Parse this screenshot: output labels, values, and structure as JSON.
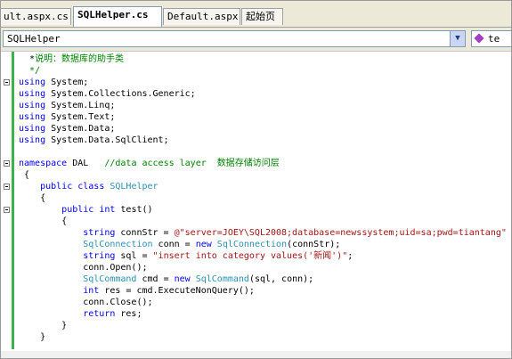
{
  "tabs": [
    {
      "label": "ult.aspx.cs"
    },
    {
      "label": "SQLHelper.cs"
    },
    {
      "label": "Default.aspx"
    },
    {
      "label": "起始页"
    }
  ],
  "nav": {
    "type_combo": "SQLHelper",
    "member_combo": "te"
  },
  "code": {
    "l1": [
      {
        "t": "  *",
        "c": ""
      },
      {
        "t": "说明：数据库的助手类",
        "c": "cm cjk"
      }
    ],
    "l2": [
      {
        "t": "  */",
        "c": "cm"
      }
    ],
    "l3": [
      {
        "t": "using",
        "c": "kw"
      },
      {
        "t": " System;",
        "c": ""
      }
    ],
    "l4": [
      {
        "t": "using",
        "c": "kw"
      },
      {
        "t": " System.Collections.Generic;",
        "c": ""
      }
    ],
    "l5": [
      {
        "t": "using",
        "c": "kw"
      },
      {
        "t": " System.Linq;",
        "c": ""
      }
    ],
    "l6": [
      {
        "t": "using",
        "c": "kw"
      },
      {
        "t": " System.Text;",
        "c": ""
      }
    ],
    "l7": [
      {
        "t": "using",
        "c": "kw"
      },
      {
        "t": " System.Data;",
        "c": ""
      }
    ],
    "l8": [
      {
        "t": "using",
        "c": "kw"
      },
      {
        "t": " System.Data.SqlClient;",
        "c": ""
      }
    ],
    "l9": [
      {
        "t": "namespace",
        "c": "kw"
      },
      {
        "t": " DAL   ",
        "c": ""
      },
      {
        "t": "//data access layer  ",
        "c": "cm"
      },
      {
        "t": "数据存储访问层",
        "c": "cm cjk"
      }
    ],
    "l10": [
      {
        "t": " {",
        "c": ""
      }
    ],
    "l11": [
      {
        "t": "    ",
        "c": ""
      },
      {
        "t": "public class",
        "c": "kw"
      },
      {
        "t": " ",
        "c": ""
      },
      {
        "t": "SQLHelper",
        "c": "ty"
      }
    ],
    "l12": [
      {
        "t": "    {",
        "c": ""
      }
    ],
    "l13": [
      {
        "t": "        ",
        "c": ""
      },
      {
        "t": "public int",
        "c": "kw"
      },
      {
        "t": " test()",
        "c": ""
      }
    ],
    "l14": [
      {
        "t": "        {",
        "c": ""
      }
    ],
    "l15": [
      {
        "t": "            ",
        "c": ""
      },
      {
        "t": "string",
        "c": "kw"
      },
      {
        "t": " connStr = ",
        "c": ""
      },
      {
        "t": "@\"server=JOEY\\SQL2008;database=newssystem;uid=sa;pwd=tiantang\"",
        "c": "str"
      }
    ],
    "l16": [
      {
        "t": "            ",
        "c": ""
      },
      {
        "t": "SqlConnection",
        "c": "ty"
      },
      {
        "t": " conn = ",
        "c": ""
      },
      {
        "t": "new",
        "c": "kw"
      },
      {
        "t": " ",
        "c": ""
      },
      {
        "t": "SqlConnection",
        "c": "ty"
      },
      {
        "t": "(connStr);",
        "c": ""
      }
    ],
    "l17": [
      {
        "t": "            ",
        "c": ""
      },
      {
        "t": "string",
        "c": "kw"
      },
      {
        "t": " sql = ",
        "c": ""
      },
      {
        "t": "\"insert into category values('",
        "c": "str"
      },
      {
        "t": "新闻",
        "c": "str cjk"
      },
      {
        "t": "')\"",
        "c": "str"
      },
      {
        "t": ";",
        "c": ""
      }
    ],
    "l18": [
      {
        "t": "            conn.Open();",
        "c": ""
      }
    ],
    "l19": [
      {
        "t": "            ",
        "c": ""
      },
      {
        "t": "SqlCommand",
        "c": "ty"
      },
      {
        "t": " cmd = ",
        "c": ""
      },
      {
        "t": "new",
        "c": "kw"
      },
      {
        "t": " ",
        "c": ""
      },
      {
        "t": "SqlCommand",
        "c": "ty"
      },
      {
        "t": "(sql, conn);",
        "c": ""
      }
    ],
    "l20": [
      {
        "t": "            ",
        "c": ""
      },
      {
        "t": "int",
        "c": "kw"
      },
      {
        "t": " res = cmd.ExecuteNonQuery();",
        "c": ""
      }
    ],
    "l21": [
      {
        "t": "            conn.Close();",
        "c": ""
      }
    ],
    "l22": [
      {
        "t": "            ",
        "c": ""
      },
      {
        "t": "return",
        "c": "kw"
      },
      {
        "t": " res;",
        "c": ""
      }
    ],
    "l23": [
      {
        "t": "        }",
        "c": ""
      }
    ],
    "l24": [
      {
        "t": "    }",
        "c": ""
      }
    ]
  }
}
